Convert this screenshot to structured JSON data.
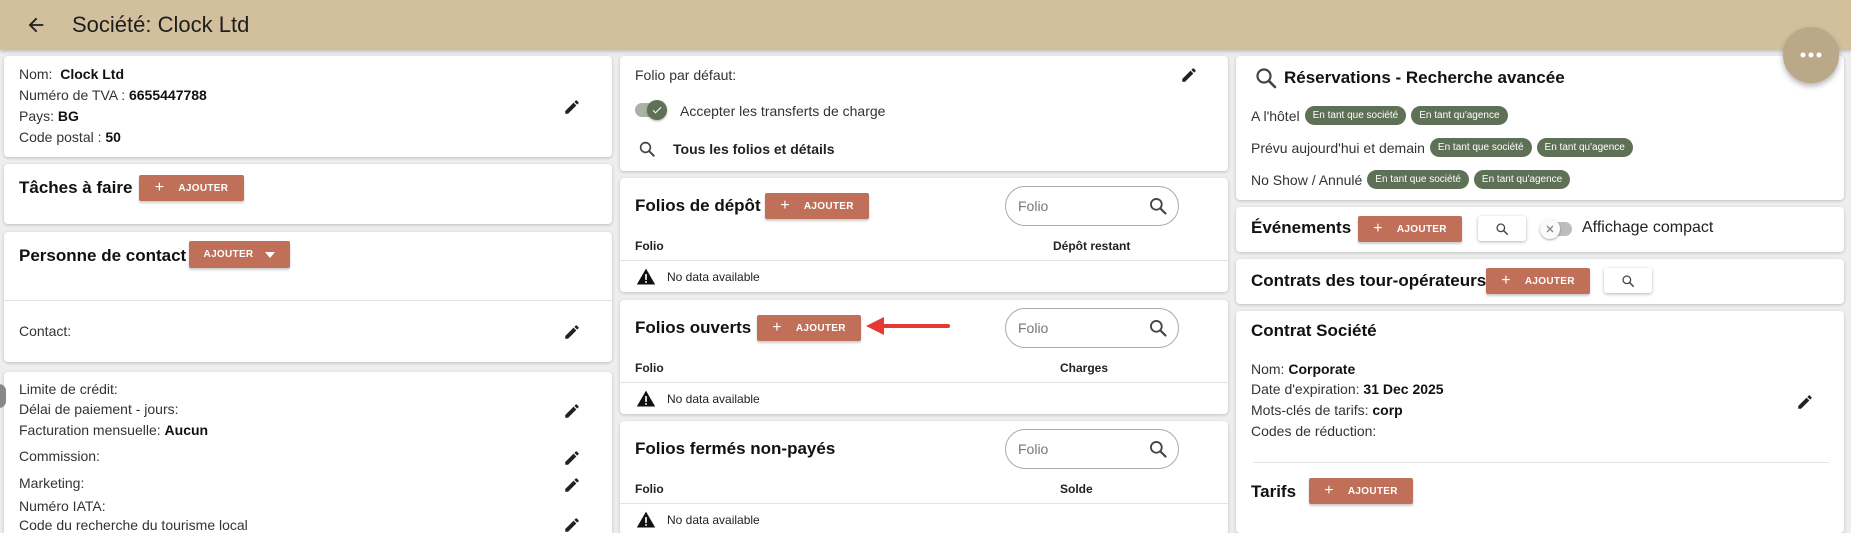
{
  "header": {
    "title": "Société: Clock Ltd"
  },
  "company": {
    "name_label": "Nom:",
    "name_value": "Clock Ltd",
    "vat_label": "Numéro de TVA :",
    "vat_value": "6655447788",
    "country_label": "Pays:",
    "country_value": "BG",
    "postal_label": "Code postal :",
    "postal_value": "50"
  },
  "tasks": {
    "title": "Tâches à faire",
    "add_label": "AJOUTER"
  },
  "contact_person": {
    "title": "Personne de contact",
    "add_label": "AJOUTER",
    "contact_label": "Contact:"
  },
  "billing": {
    "credit_limit_label": "Limite de crédit:",
    "payment_delay_label": "Délai de paiement - jours:",
    "monthly_billing_label": "Facturation mensuelle:",
    "monthly_billing_value": "Aucun",
    "commission_label": "Commission:",
    "marketing_label": "Marketing:",
    "iata_label": "Numéro IATA:",
    "cut_line": "Code du recherche du tourisme local"
  },
  "folio_settings": {
    "default_folio_label": "Folio par défaut:",
    "accept_transfers_label": "Accepter les transferts de charge",
    "accept_transfers_on": true,
    "all_folios_label": "Tous les folios et détails"
  },
  "deposit_folios": {
    "title": "Folios de dépôt",
    "add_label": "AJOUTER",
    "search_placeholder": "Folio",
    "col_folio": "Folio",
    "col_amount": "Dépôt restant",
    "empty_text": "No data available"
  },
  "open_folios": {
    "title": "Folios ouverts",
    "add_label": "AJOUTER",
    "search_placeholder": "Folio",
    "col_folio": "Folio",
    "col_amount": "Charges",
    "empty_text": "No data available"
  },
  "closed_unpaid_folios": {
    "title": "Folios fermés non-payés",
    "search_placeholder": "Folio",
    "col_folio": "Folio",
    "col_amount": "Solde",
    "empty_text": "No data available"
  },
  "reservations": {
    "title": "Réservations - Recherche avancée",
    "rows": [
      {
        "label": "A l'hôtel",
        "chip_company": "En tant que société",
        "chip_agency": "En tant qu'agence"
      },
      {
        "label": "Prévu aujourd'hui et demain",
        "chip_company": "En tant que société",
        "chip_agency": "En tant qu'agence"
      },
      {
        "label": "No Show / Annulé",
        "chip_company": "En tant que société",
        "chip_agency": "En tant qu'agence"
      }
    ]
  },
  "events": {
    "title": "Événements",
    "add_label": "AJOUTER",
    "compact_label": "Affichage compact",
    "compact_on": false
  },
  "tour_contracts": {
    "title": "Contrats des tour-opérateurs",
    "add_label": "AJOUTER"
  },
  "company_contract": {
    "title": "Contrat Société",
    "name_label": "Nom:",
    "name_value": "Corporate",
    "expiry_label": "Date d'expiration:",
    "expiry_value": "31 Dec 2025",
    "keywords_label": "Mots-clés de tarifs:",
    "keywords_value": "corp",
    "discount_label": "Codes de réduction:"
  },
  "rates": {
    "title": "Tarifs",
    "add_label": "AJOUTER"
  },
  "colors": {
    "header_bg": "#d2c09c",
    "accent_button": "#c06f58",
    "chip_bg": "#5e7056",
    "arrow": "#e53935",
    "toggle_on": "#5e7056"
  }
}
